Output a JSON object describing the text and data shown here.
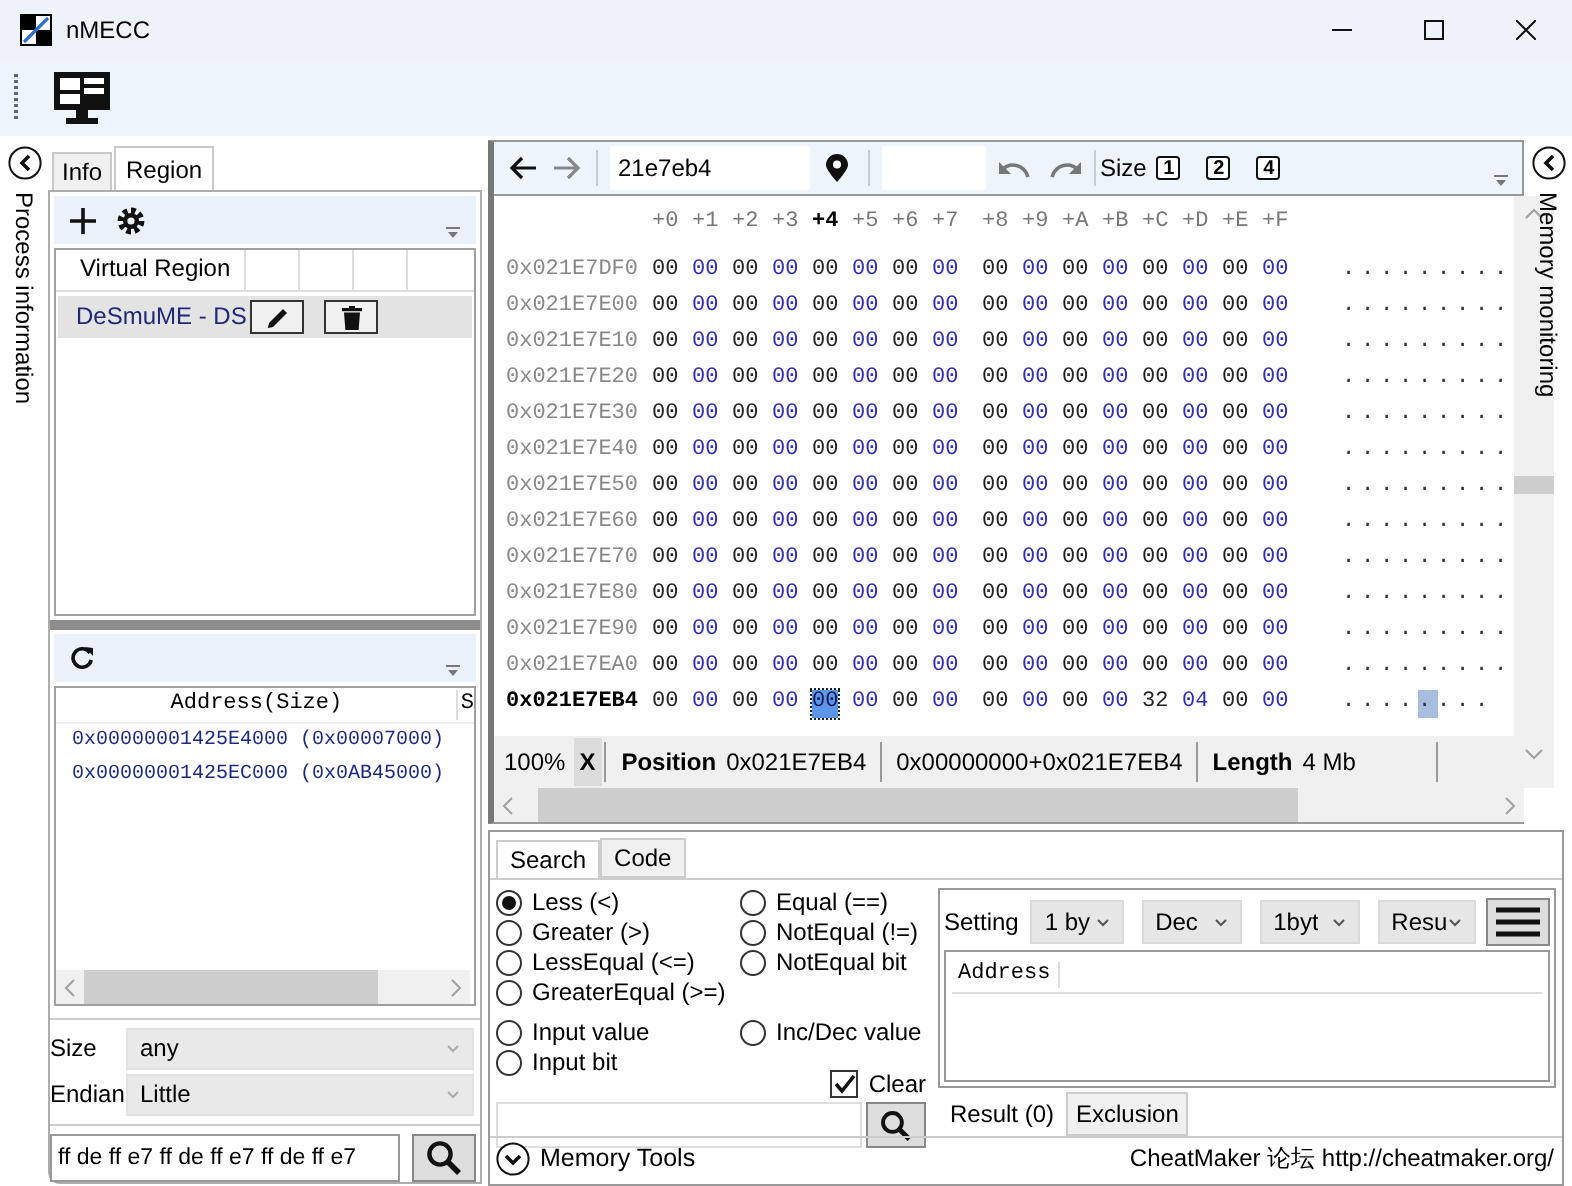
{
  "window": {
    "title": "nMECC"
  },
  "left_strip": {
    "label": "Process information"
  },
  "left_tabs": [
    {
      "label": "Info",
      "selected": false
    },
    {
      "label": "Region",
      "selected": true
    }
  ],
  "region_table": {
    "columns": [
      "Virtual Region"
    ],
    "rows": [
      {
        "name": "DeSmuME - DS",
        "selected": true
      }
    ]
  },
  "address_table": {
    "columns": [
      "Address(Size)",
      "S"
    ],
    "rows": [
      "0x00000001425E4000 (0x00007000)",
      "0x00000001425EC000 (0x0AB45000)"
    ]
  },
  "size": {
    "label": "Size",
    "value": "any"
  },
  "endian": {
    "label": "Endian",
    "value": "Little"
  },
  "pattern_field": {
    "value": "ff de ff e7 ff de ff e7 ff de ff e7"
  },
  "hex": {
    "address_input": "21e7eb4",
    "size_label": "Size",
    "size_buttons": [
      "1",
      "2",
      "4"
    ],
    "columns": [
      {
        "label": "+0",
        "selected": false
      },
      {
        "label": "+1",
        "selected": false
      },
      {
        "label": "+2",
        "selected": false
      },
      {
        "label": "+3",
        "selected": false
      },
      {
        "label": "+4",
        "selected": true
      },
      {
        "label": "+5",
        "selected": false
      },
      {
        "label": "+6",
        "selected": false
      },
      {
        "label": "+7",
        "selected": false
      },
      {
        "label": "+8",
        "selected": false
      },
      {
        "label": "+9",
        "selected": false
      },
      {
        "label": "+A",
        "selected": false
      },
      {
        "label": "+B",
        "selected": false
      },
      {
        "label": "+C",
        "selected": false
      },
      {
        "label": "+D",
        "selected": false
      },
      {
        "label": "+E",
        "selected": false
      },
      {
        "label": "+F",
        "selected": false
      }
    ],
    "rows": [
      {
        "address": "0x021E7DF0",
        "current": false,
        "bytes": [
          "00",
          "00",
          "00",
          "00",
          "00",
          "00",
          "00",
          "00",
          "00",
          "00",
          "00",
          "00",
          "00",
          "00",
          "00",
          "00"
        ],
        "ascii": [
          {
            "text": ".........",
            "selected": false
          }
        ]
      },
      {
        "address": "0x021E7E00",
        "current": false,
        "bytes": [
          "00",
          "00",
          "00",
          "00",
          "00",
          "00",
          "00",
          "00",
          "00",
          "00",
          "00",
          "00",
          "00",
          "00",
          "00",
          "00"
        ],
        "ascii": [
          {
            "text": ".........",
            "selected": false
          }
        ]
      },
      {
        "address": "0x021E7E10",
        "current": false,
        "bytes": [
          "00",
          "00",
          "00",
          "00",
          "00",
          "00",
          "00",
          "00",
          "00",
          "00",
          "00",
          "00",
          "00",
          "00",
          "00",
          "00"
        ],
        "ascii": [
          {
            "text": ".........",
            "selected": false
          }
        ]
      },
      {
        "address": "0x021E7E20",
        "current": false,
        "bytes": [
          "00",
          "00",
          "00",
          "00",
          "00",
          "00",
          "00",
          "00",
          "00",
          "00",
          "00",
          "00",
          "00",
          "00",
          "00",
          "00"
        ],
        "ascii": [
          {
            "text": ".........",
            "selected": false
          }
        ]
      },
      {
        "address": "0x021E7E30",
        "current": false,
        "bytes": [
          "00",
          "00",
          "00",
          "00",
          "00",
          "00",
          "00",
          "00",
          "00",
          "00",
          "00",
          "00",
          "00",
          "00",
          "00",
          "00"
        ],
        "ascii": [
          {
            "text": ".........",
            "selected": false
          }
        ]
      },
      {
        "address": "0x021E7E40",
        "current": false,
        "bytes": [
          "00",
          "00",
          "00",
          "00",
          "00",
          "00",
          "00",
          "00",
          "00",
          "00",
          "00",
          "00",
          "00",
          "00",
          "00",
          "00"
        ],
        "ascii": [
          {
            "text": ".........",
            "selected": false
          }
        ]
      },
      {
        "address": "0x021E7E50",
        "current": false,
        "bytes": [
          "00",
          "00",
          "00",
          "00",
          "00",
          "00",
          "00",
          "00",
          "00",
          "00",
          "00",
          "00",
          "00",
          "00",
          "00",
          "00"
        ],
        "ascii": [
          {
            "text": ".........",
            "selected": false
          }
        ]
      },
      {
        "address": "0x021E7E60",
        "current": false,
        "bytes": [
          "00",
          "00",
          "00",
          "00",
          "00",
          "00",
          "00",
          "00",
          "00",
          "00",
          "00",
          "00",
          "00",
          "00",
          "00",
          "00"
        ],
        "ascii": [
          {
            "text": ".........",
            "selected": false
          }
        ]
      },
      {
        "address": "0x021E7E70",
        "current": false,
        "bytes": [
          "00",
          "00",
          "00",
          "00",
          "00",
          "00",
          "00",
          "00",
          "00",
          "00",
          "00",
          "00",
          "00",
          "00",
          "00",
          "00"
        ],
        "ascii": [
          {
            "text": ".........",
            "selected": false
          }
        ]
      },
      {
        "address": "0x021E7E80",
        "current": false,
        "bytes": [
          "00",
          "00",
          "00",
          "00",
          "00",
          "00",
          "00",
          "00",
          "00",
          "00",
          "00",
          "00",
          "00",
          "00",
          "00",
          "00"
        ],
        "ascii": [
          {
            "text": ".........",
            "selected": false
          }
        ]
      },
      {
        "address": "0x021E7E90",
        "current": false,
        "bytes": [
          "00",
          "00",
          "00",
          "00",
          "00",
          "00",
          "00",
          "00",
          "00",
          "00",
          "00",
          "00",
          "00",
          "00",
          "00",
          "00"
        ],
        "ascii": [
          {
            "text": ".........",
            "selected": false
          }
        ]
      },
      {
        "address": "0x021E7EA0",
        "current": false,
        "bytes": [
          "00",
          "00",
          "00",
          "00",
          "00",
          "00",
          "00",
          "00",
          "00",
          "00",
          "00",
          "00",
          "00",
          "00",
          "00",
          "00"
        ],
        "ascii": [
          {
            "text": ".........",
            "selected": false
          }
        ]
      },
      {
        "address": "0x021E7EB4",
        "current": true,
        "bytes": [
          "00",
          "00",
          "00",
          "00",
          "00",
          "00",
          "00",
          "00",
          "00",
          "00",
          "00",
          "00",
          "32",
          "04",
          "00",
          "00"
        ],
        "ascii": [
          {
            "text": "....",
            "selected": false
          },
          {
            "text": ".",
            "selected": true
          },
          {
            "text": "...",
            "selected": false
          }
        ]
      }
    ],
    "status": {
      "zoom": "100%",
      "close": "X",
      "position_label": "Position",
      "position": "0x021E7EB4",
      "offset": "0x00000000+0x021E7EB4",
      "length_label": "Length",
      "length": "4 Mb"
    }
  },
  "right_strip": {
    "label": "Memory monitoring"
  },
  "search_tabs": [
    {
      "label": "Search",
      "selected": true
    },
    {
      "label": "Code",
      "selected": false
    }
  ],
  "options_left": [
    {
      "label": "Less (<)",
      "selected": true
    },
    {
      "label": "Greater (>)",
      "selected": false
    },
    {
      "label": "LessEqual (<=)",
      "selected": false
    },
    {
      "label": "GreaterEqual (>=)",
      "selected": false
    },
    {
      "label": "Input value",
      "selected": false
    },
    {
      "label": "Input bit",
      "selected": false
    }
  ],
  "options_right": [
    {
      "label": "Equal (==)",
      "selected": false
    },
    {
      "label": "NotEqual (!=)",
      "selected": false
    },
    {
      "label": "NotEqual bit",
      "selected": false
    },
    {
      "label": "Inc/Dec value",
      "selected": false
    }
  ],
  "clear": {
    "label": "Clear",
    "checked": true
  },
  "setting": {
    "label": "Setting",
    "dropdowns": [
      "1 by",
      "Dec",
      "1byt",
      "Resu"
    ]
  },
  "result_table": {
    "columns": [
      "Address"
    ]
  },
  "result_tabs": [
    {
      "label": "Result (0)",
      "selected": true
    },
    {
      "label": "Exclusion",
      "selected": false
    }
  ],
  "footer": {
    "tools": "Memory Tools",
    "link": "CheatMaker 论坛 http://cheatmaker.org/"
  }
}
